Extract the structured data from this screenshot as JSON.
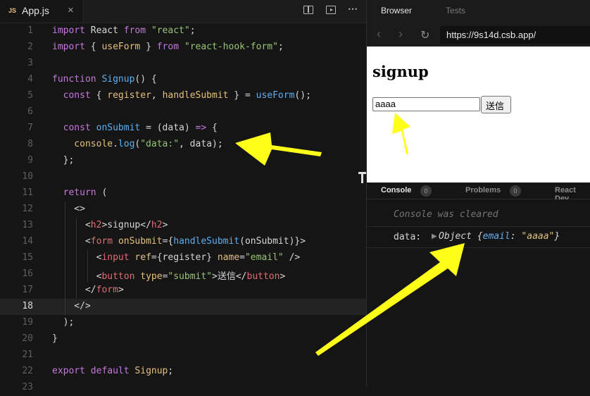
{
  "tab": {
    "icon": "JS",
    "name": "App.js",
    "close": "×"
  },
  "editor": {
    "active_line": 18,
    "lines": [
      {
        "n": "1",
        "tokens": [
          {
            "t": "import",
            "c": "kw"
          },
          {
            "t": " React ",
            "c": "txt"
          },
          {
            "t": "from",
            "c": "kw"
          },
          {
            "t": " ",
            "c": "txt"
          },
          {
            "t": "\"react\"",
            "c": "str"
          },
          {
            "t": ";",
            "c": "txt"
          }
        ]
      },
      {
        "n": "2",
        "tokens": [
          {
            "t": "import",
            "c": "kw"
          },
          {
            "t": " { ",
            "c": "txt"
          },
          {
            "t": "useForm",
            "c": "var"
          },
          {
            "t": " } ",
            "c": "txt"
          },
          {
            "t": "from",
            "c": "kw"
          },
          {
            "t": " ",
            "c": "txt"
          },
          {
            "t": "\"react-hook-form\"",
            "c": "str"
          },
          {
            "t": ";",
            "c": "txt"
          }
        ]
      },
      {
        "n": "3",
        "tokens": []
      },
      {
        "n": "4",
        "tokens": [
          {
            "t": "function",
            "c": "kw"
          },
          {
            "t": " ",
            "c": "txt"
          },
          {
            "t": "Signup",
            "c": "fn"
          },
          {
            "t": "() {",
            "c": "txt"
          }
        ]
      },
      {
        "n": "5",
        "tokens": [
          {
            "t": "  const",
            "c": "kw"
          },
          {
            "t": " { ",
            "c": "txt"
          },
          {
            "t": "register",
            "c": "var"
          },
          {
            "t": ", ",
            "c": "txt"
          },
          {
            "t": "handleSubmit",
            "c": "var"
          },
          {
            "t": " } = ",
            "c": "txt"
          },
          {
            "t": "useForm",
            "c": "fn"
          },
          {
            "t": "();",
            "c": "txt"
          }
        ]
      },
      {
        "n": "6",
        "tokens": []
      },
      {
        "n": "7",
        "tokens": [
          {
            "t": "  const",
            "c": "kw"
          },
          {
            "t": " ",
            "c": "txt"
          },
          {
            "t": "onSubmit",
            "c": "fn"
          },
          {
            "t": " = (data) ",
            "c": "txt"
          },
          {
            "t": "=>",
            "c": "kw"
          },
          {
            "t": " {",
            "c": "txt"
          }
        ]
      },
      {
        "n": "8",
        "tokens": [
          {
            "t": "    console",
            "c": "var"
          },
          {
            "t": ".",
            "c": "txt"
          },
          {
            "t": "log",
            "c": "fn"
          },
          {
            "t": "(",
            "c": "txt"
          },
          {
            "t": "\"data:\"",
            "c": "str"
          },
          {
            "t": ", data);",
            "c": "txt"
          }
        ]
      },
      {
        "n": "9",
        "tokens": [
          {
            "t": "  };",
            "c": "txt"
          }
        ]
      },
      {
        "n": "10",
        "tokens": []
      },
      {
        "n": "11",
        "tokens": [
          {
            "t": "  return",
            "c": "kw"
          },
          {
            "t": " (",
            "c": "txt"
          }
        ]
      },
      {
        "n": "12",
        "tokens": [
          {
            "t": "    <>",
            "c": "txt"
          }
        ]
      },
      {
        "n": "13",
        "tokens": [
          {
            "t": "      <",
            "c": "txt"
          },
          {
            "t": "h2",
            "c": "pl"
          },
          {
            "t": ">signup</",
            "c": "txt"
          },
          {
            "t": "h2",
            "c": "pl"
          },
          {
            "t": ">",
            "c": "txt"
          }
        ]
      },
      {
        "n": "14",
        "tokens": [
          {
            "t": "      <",
            "c": "txt"
          },
          {
            "t": "form",
            "c": "pl"
          },
          {
            "t": " ",
            "c": "txt"
          },
          {
            "t": "onSubmit",
            "c": "var"
          },
          {
            "t": "={",
            "c": "txt"
          },
          {
            "t": "handleSubmit",
            "c": "fn"
          },
          {
            "t": "(onSubmit)}>",
            "c": "txt"
          }
        ]
      },
      {
        "n": "15",
        "tokens": [
          {
            "t": "        <",
            "c": "txt"
          },
          {
            "t": "input",
            "c": "pl"
          },
          {
            "t": " ",
            "c": "txt"
          },
          {
            "t": "ref",
            "c": "var"
          },
          {
            "t": "={register} ",
            "c": "txt"
          },
          {
            "t": "name",
            "c": "var"
          },
          {
            "t": "=",
            "c": "txt"
          },
          {
            "t": "\"email\"",
            "c": "str"
          },
          {
            "t": " />",
            "c": "txt"
          }
        ]
      },
      {
        "n": "16",
        "tokens": [
          {
            "t": "        <",
            "c": "txt"
          },
          {
            "t": "button",
            "c": "pl"
          },
          {
            "t": " ",
            "c": "txt"
          },
          {
            "t": "type",
            "c": "var"
          },
          {
            "t": "=",
            "c": "txt"
          },
          {
            "t": "\"submit\"",
            "c": "str"
          },
          {
            "t": ">送信</",
            "c": "txt"
          },
          {
            "t": "button",
            "c": "pl"
          },
          {
            "t": ">",
            "c": "txt"
          }
        ]
      },
      {
        "n": "17",
        "tokens": [
          {
            "t": "      </",
            "c": "txt"
          },
          {
            "t": "form",
            "c": "pl"
          },
          {
            "t": ">",
            "c": "txt"
          }
        ]
      },
      {
        "n": "18",
        "tokens": [
          {
            "t": "    </>",
            "c": "txt"
          }
        ]
      },
      {
        "n": "19",
        "tokens": [
          {
            "t": "  );",
            "c": "txt"
          }
        ]
      },
      {
        "n": "20",
        "tokens": [
          {
            "t": "}",
            "c": "txt"
          }
        ]
      },
      {
        "n": "21",
        "tokens": []
      },
      {
        "n": "22",
        "tokens": [
          {
            "t": "export",
            "c": "kw"
          },
          {
            "t": " ",
            "c": "txt"
          },
          {
            "t": "default",
            "c": "kw"
          },
          {
            "t": " ",
            "c": "txt"
          },
          {
            "t": "Signup",
            "c": "var"
          },
          {
            "t": ";",
            "c": "txt"
          }
        ]
      },
      {
        "n": "23",
        "tokens": []
      }
    ]
  },
  "browser": {
    "tabs": [
      "Browser",
      "Tests"
    ],
    "url": "https://9s14d.csb.app/",
    "preview": {
      "heading": "signup",
      "input_value": "aaaa",
      "button_label": "送信"
    }
  },
  "console": {
    "tabs": [
      {
        "label": "Console",
        "count": "0"
      },
      {
        "label": "Problems",
        "count": "0"
      },
      {
        "label": "React Dev",
        "count": null
      }
    ],
    "cleared": "Console was cleared",
    "log": {
      "key": "data:",
      "prefix": "Object {",
      "obj_key": "email",
      "colon": ": ",
      "obj_val": "\"aaaa\"",
      "suffix": "}"
    }
  },
  "colors": {
    "annotation_arrow": "#ffff1a",
    "editor_bg": "#151515"
  }
}
